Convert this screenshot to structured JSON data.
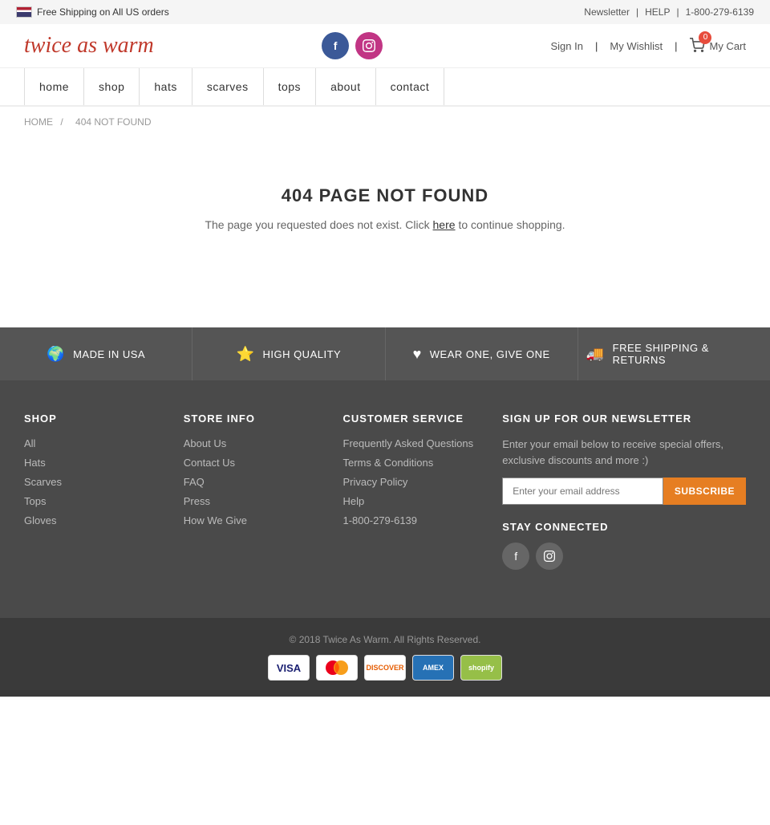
{
  "topbar": {
    "shipping_text": "Free Shipping on All US orders",
    "newsletter_label": "Newsletter",
    "help_label": "HELP",
    "phone": "1-800-279-6139"
  },
  "header": {
    "logo_text": "twice as warm",
    "signin_label": "Sign In",
    "wishlist_label": "My Wishlist",
    "cart_label": "My Cart",
    "cart_count": "0"
  },
  "nav": {
    "items": [
      {
        "label": "home",
        "href": "#"
      },
      {
        "label": "shop",
        "href": "#"
      },
      {
        "label": "hats",
        "href": "#"
      },
      {
        "label": "scarves",
        "href": "#"
      },
      {
        "label": "tops",
        "href": "#"
      },
      {
        "label": "about",
        "href": "#"
      },
      {
        "label": "contact",
        "href": "#"
      }
    ]
  },
  "breadcrumb": {
    "home_label": "HOME",
    "separator": "/",
    "current": "404 NOT FOUND"
  },
  "error": {
    "title": "404 PAGE NOT FOUND",
    "message_pre": "The page you requested does not exist. Click",
    "link_text": "here",
    "message_post": "to continue shopping."
  },
  "features": [
    {
      "icon": "🌍",
      "label": "MADE IN USA",
      "name": "made-in-usa"
    },
    {
      "icon": "⭐",
      "label": "HIGH QUALITY",
      "name": "high-quality"
    },
    {
      "icon": "♥",
      "label": "WEAR ONE, GIVE ONE",
      "name": "wear-one-give-one"
    },
    {
      "icon": "🚚",
      "label": "FREE SHIPPING & RETURNS",
      "name": "free-shipping"
    }
  ],
  "footer": {
    "shop_title": "SHOP",
    "shop_links": [
      {
        "label": "All",
        "href": "#"
      },
      {
        "label": "Hats",
        "href": "#"
      },
      {
        "label": "Scarves",
        "href": "#"
      },
      {
        "label": "Tops",
        "href": "#"
      },
      {
        "label": "Gloves",
        "href": "#"
      }
    ],
    "store_title": "STORE INFO",
    "store_links": [
      {
        "label": "About Us",
        "href": "#"
      },
      {
        "label": "Contact Us",
        "href": "#"
      },
      {
        "label": "FAQ",
        "href": "#"
      },
      {
        "label": "Press",
        "href": "#"
      },
      {
        "label": "How We Give",
        "href": "#"
      }
    ],
    "service_title": "CUSTOMER SERVICE",
    "service_links": [
      {
        "label": "Frequently Asked Questions",
        "href": "#"
      },
      {
        "label": "Terms & Conditions",
        "href": "#"
      },
      {
        "label": "Privacy Policy",
        "href": "#"
      },
      {
        "label": "Help",
        "href": "#"
      },
      {
        "label": "1-800-279-6139",
        "href": "#"
      }
    ],
    "newsletter_title": "SIGN UP FOR OUR NEWSLETTER",
    "newsletter_text": "Enter your email below to receive special offers, exclusive discounts and more :)",
    "email_placeholder": "Enter your email address",
    "subscribe_label": "SUBSCRIBE",
    "stay_connected_title": "STAY CONNECTED"
  },
  "footer_bottom": {
    "copyright": "© 2018 Twice As Warm. All Rights Reserved.",
    "payment_methods": [
      "VISA",
      "MC",
      "DISCOVER",
      "AMEX",
      "SHOPIFY"
    ]
  }
}
